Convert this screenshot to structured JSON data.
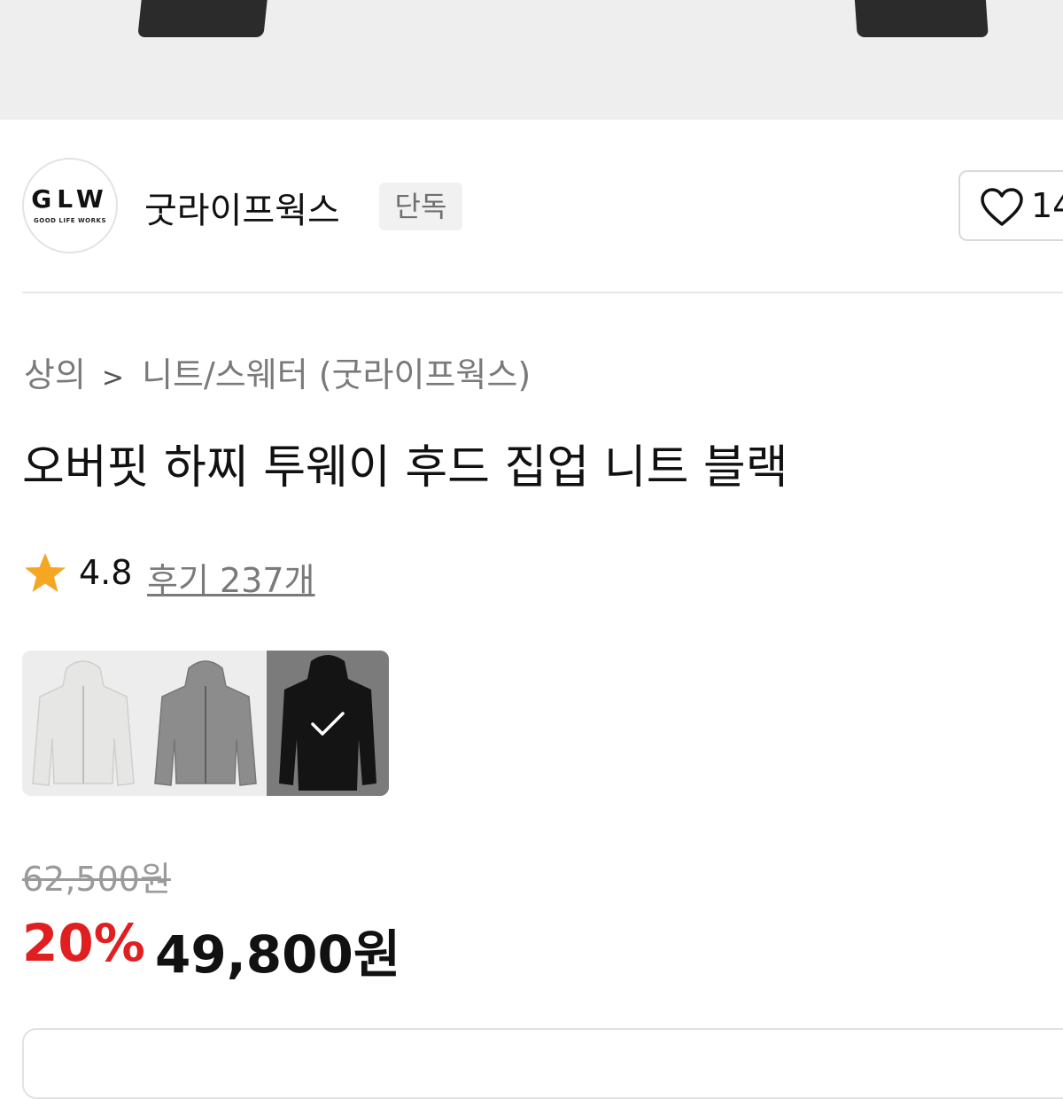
{
  "brand": {
    "logo_mark": "GLW",
    "logo_sub": "GOOD LIFE WORKS",
    "name": "굿라이프웍스",
    "badge": "단독"
  },
  "like": {
    "icon": "heart-outline-icon",
    "count": "14"
  },
  "breadcrumb": {
    "category": "상의",
    "separator": ">",
    "subcategory": "니트/스웨터 (굿라이프웍스)"
  },
  "product": {
    "title": "오버핏 하찌 투웨이 후드 집업 니트 블랙"
  },
  "rating": {
    "icon": "star-icon",
    "value": "4.8",
    "reviews_label": "후기 237개"
  },
  "swatches": [
    {
      "color": "#e6e6e4",
      "selected": false
    },
    {
      "color": "#8c8c8c",
      "selected": false
    },
    {
      "color": "#111111",
      "selected": true
    }
  ],
  "price": {
    "original": "62,500원",
    "discount": "20%",
    "final": "49,800원"
  },
  "colors": {
    "discount_red": "#e02020",
    "star_orange": "#f5a623"
  }
}
